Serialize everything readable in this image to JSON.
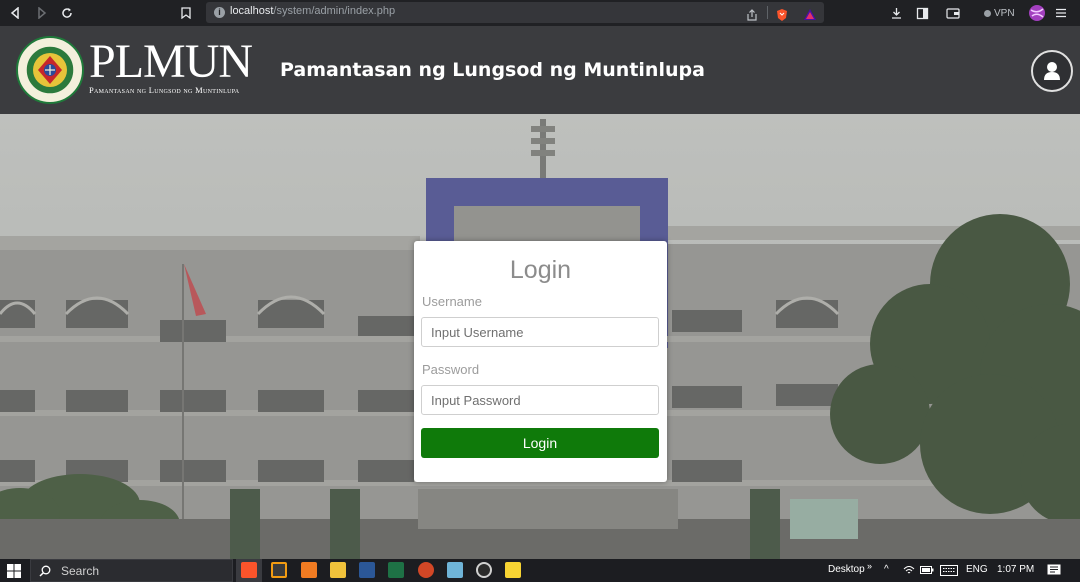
{
  "browser": {
    "url_host": "localhost",
    "url_path": "/system/admin/index.php",
    "vpn_label": "VPN",
    "icons": [
      "back-icon",
      "forward-icon",
      "reload-icon",
      "bookmark-icon",
      "info-icon",
      "share-icon",
      "brave-shield-icon",
      "brave-rewards-icon",
      "download-icon",
      "sidebar-icon",
      "wallet-icon",
      "vpn-icon",
      "profile-icon",
      "menu-icon"
    ]
  },
  "header": {
    "brand_name": "PLMUN",
    "brand_subtitle": "Pamantasan ng Lungsod ng Muntinlupa",
    "site_title": "Pamantasan ng Lungsod ng Muntinlupa",
    "icons": [
      "university-seal-icon",
      "user-icon"
    ]
  },
  "login": {
    "title": "Login",
    "username_label": "Username",
    "username_placeholder": "Input Username",
    "password_label": "Password",
    "password_placeholder": "Input Password",
    "submit_label": "Login",
    "button_color": "#0f7a0a"
  },
  "taskbar": {
    "search_label": "Search",
    "desktop_label": "Desktop",
    "language": "ENG",
    "time": "1:07 PM",
    "apps": [
      "brave-icon",
      "sublime-text-icon",
      "xampp-icon",
      "file-explorer-icon",
      "word-icon",
      "excel-icon",
      "powerpoint-icon",
      "notepad-icon",
      "obs-icon",
      "sticky-notes-icon"
    ]
  }
}
